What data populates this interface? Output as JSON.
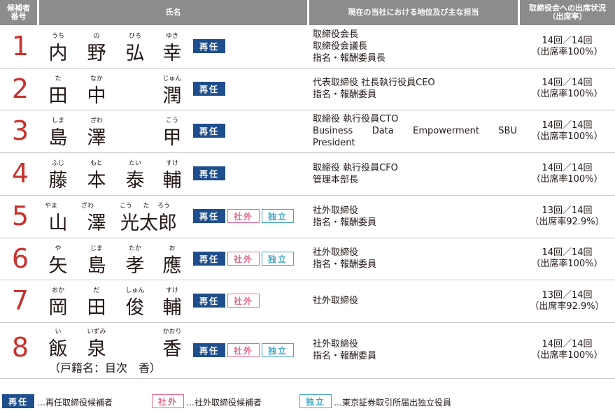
{
  "header": {
    "number": "候補者\n番号",
    "name": "氏名",
    "position": "現在の当社における地位及び主な担当",
    "attendance": "取締役会への出席状況\n（出席率）"
  },
  "badges": {
    "reappoint": "再任",
    "outside": "社外",
    "independent": "独立"
  },
  "candidates": [
    {
      "number": "1",
      "furigana": [
        "うち",
        "の",
        "ひろ",
        "ゆき"
      ],
      "kanji": [
        "内",
        "野",
        "弘",
        "幸"
      ],
      "position": [
        "取締役会長",
        "取締役会議長",
        "指名・報酬委員長"
      ],
      "attendance": [
        "14回／14回",
        "（出席率100%）"
      ],
      "badges": [
        "reappoint"
      ]
    },
    {
      "number": "2",
      "furigana": [
        "た",
        "なか",
        "",
        "じゅん"
      ],
      "kanji": [
        "田",
        "中",
        "",
        "潤"
      ],
      "position": [
        "代表取締役 社長執行役員CEO",
        "指名・報酬委員"
      ],
      "attendance": [
        "14回／14回",
        "（出席率100%）"
      ],
      "badges": [
        "reappoint"
      ]
    },
    {
      "number": "3",
      "furigana": [
        "しま",
        "ざわ",
        "",
        "こう"
      ],
      "kanji": [
        "島",
        "澤",
        "",
        "甲"
      ],
      "position": [
        "取締役 執行役員CTO",
        "Business Data Empowerment SBU",
        "President"
      ],
      "attendance": [
        "14回／14回",
        "（出席率100%）"
      ],
      "badges": [
        "reappoint"
      ]
    },
    {
      "number": "4",
      "furigana": [
        "ふじ",
        "もと",
        "たい",
        "すけ"
      ],
      "kanji": [
        "藤",
        "本",
        "泰",
        "輔"
      ],
      "position": [
        "取締役 執行役員CFO",
        "管理本部長"
      ],
      "attendance": [
        "14回／14回",
        "（出席率100%）"
      ],
      "badges": [
        "reappoint"
      ]
    },
    {
      "number": "5",
      "furigana": [
        "やま",
        "ざわ",
        "こう",
        "た",
        "ろう"
      ],
      "kanji": [
        "山",
        "澤",
        "光太郎"
      ],
      "position": [
        "社外取締役",
        "指名・報酬委員"
      ],
      "attendance": [
        "13回／14回",
        "（出席率92.9%）"
      ],
      "badges": [
        "reappoint",
        "outside",
        "independent"
      ]
    },
    {
      "number": "6",
      "furigana": [
        "や",
        "じま",
        "たか",
        "お"
      ],
      "kanji": [
        "矢",
        "島",
        "孝",
        "應"
      ],
      "position": [
        "社外取締役",
        "指名・報酬委員"
      ],
      "attendance": [
        "14回／14回",
        "（出席率100%）"
      ],
      "badges": [
        "reappoint",
        "outside",
        "independent"
      ]
    },
    {
      "number": "7",
      "furigana": [
        "おか",
        "だ",
        "しゅん",
        "すけ"
      ],
      "kanji": [
        "岡",
        "田",
        "俊",
        "輔"
      ],
      "position": [
        "社外取締役"
      ],
      "attendance": [
        "13回／14回",
        "（出席率92.9%）"
      ],
      "badges": [
        "reappoint",
        "outside"
      ]
    },
    {
      "number": "8",
      "furigana": [
        "い",
        "いずみ",
        "",
        "かおり"
      ],
      "kanji": [
        "飯",
        "泉",
        "",
        "香"
      ],
      "note": "（戸籍名：目次　香）",
      "position": [
        "社外取締役",
        "指名・報酬委員"
      ],
      "attendance": [
        "14回／14回",
        "（出席率100%）"
      ],
      "badges": [
        "reappoint",
        "outside",
        "independent"
      ]
    }
  ],
  "legend": {
    "reappoint": "…再任取締役候補者",
    "outside": "…社外取締役候補者",
    "independent": "…東京証券取引所届出独立役員"
  },
  "colors": {
    "header_bg": "#8c8c8c",
    "number_red": "#c8322d",
    "reappoint_blue": "#1f4e8c",
    "outside_pink": "#e36a8e",
    "independent_cyan": "#43a7c6"
  }
}
